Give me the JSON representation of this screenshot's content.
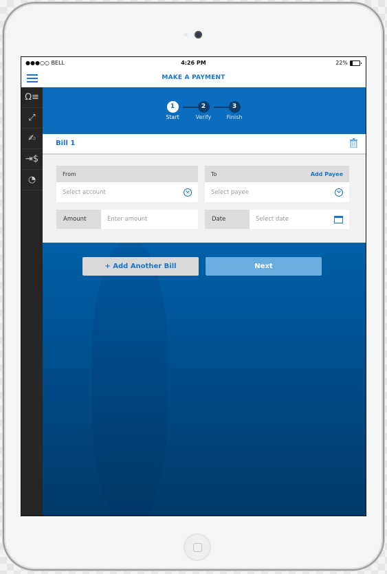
{
  "status_bar": {
    "carrier": "●●●○○ BELL",
    "time": "4:26 PM",
    "battery": "22%"
  },
  "nav": {
    "title": "MAKE A PAYMENT",
    "menu_icon": "hamburger-icon"
  },
  "sidebar": {
    "items": [
      {
        "icon": "profile-list-icon",
        "glyph": "Ω≡"
      },
      {
        "icon": "transfer-arrows-icon",
        "glyph": "⤢"
      },
      {
        "icon": "cheque-deposit-icon",
        "glyph": "✍"
      },
      {
        "icon": "pay-bill-icon",
        "glyph": "⇥$"
      },
      {
        "icon": "pie-chart-icon",
        "glyph": "◔"
      }
    ]
  },
  "stepper": {
    "steps": [
      {
        "number": "1",
        "label": "Start",
        "active": true
      },
      {
        "number": "2",
        "label": "Verify",
        "active": false
      },
      {
        "number": "3",
        "label": "Finish",
        "active": false
      }
    ]
  },
  "bill": {
    "title": "Bill 1",
    "from": {
      "label": "From",
      "placeholder": "Select account"
    },
    "to": {
      "label": "To",
      "link": "Add Payee",
      "placeholder": "Select payee"
    },
    "amount": {
      "label": "Amount",
      "placeholder": "Enter amount"
    },
    "date": {
      "label": "Date",
      "placeholder": "Select date"
    }
  },
  "actions": {
    "add_bill": "+ Add Another Bill",
    "next": "Next"
  },
  "colors": {
    "accent": "#1a75c9",
    "header_blue": "#0a6dbf",
    "next_button": "#68aee0"
  }
}
